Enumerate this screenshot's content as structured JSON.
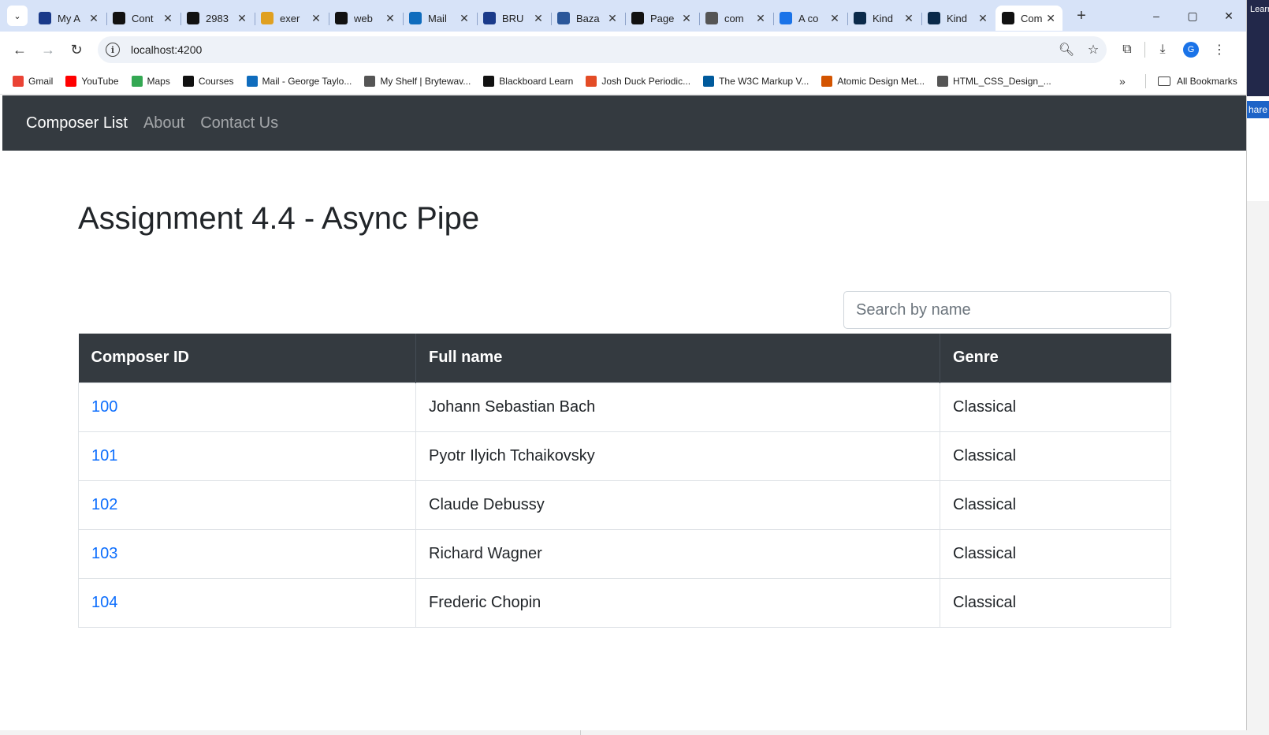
{
  "browser": {
    "tabs": [
      {
        "title": "My A",
        "favicon": "circle-icon",
        "color": "#1a3a8a"
      },
      {
        "title": "Cont",
        "favicon": "chart-icon",
        "color": "#111111"
      },
      {
        "title": "2983",
        "favicon": "blackboard-icon",
        "color": "#111111"
      },
      {
        "title": "exer",
        "favicon": "swirl-icon",
        "color": "#e0a020"
      },
      {
        "title": "web",
        "favicon": "github-icon",
        "color": "#111111"
      },
      {
        "title": "Mail",
        "favicon": "outlook-icon",
        "color": "#0f6cbd"
      },
      {
        "title": "BRU",
        "favicon": "circle-icon",
        "color": "#1a3a8a"
      },
      {
        "title": "Baza",
        "favicon": "word-icon",
        "color": "#2b579a"
      },
      {
        "title": "Page",
        "favicon": "github-icon",
        "color": "#111111"
      },
      {
        "title": "com",
        "favicon": "globe-icon",
        "color": "#555555"
      },
      {
        "title": "A co",
        "favicon": "s-icon",
        "color": "#1a73e8"
      },
      {
        "title": "Kind",
        "favicon": "k-icon",
        "color": "#0b2a4a"
      },
      {
        "title": "Kind",
        "favicon": "k-icon",
        "color": "#0b2a4a"
      },
      {
        "title": "Com",
        "favicon": "angular-icon",
        "color": "#111111",
        "active": true
      }
    ],
    "url": "localhost:4200",
    "bookmarks": [
      {
        "label": "Gmail",
        "favicon": "gmail-icon",
        "color": "#ea4335"
      },
      {
        "label": "YouTube",
        "favicon": "youtube-icon",
        "color": "#ff0000"
      },
      {
        "label": "Maps",
        "favicon": "maps-icon",
        "color": "#34a853"
      },
      {
        "label": "Courses",
        "favicon": "chart-icon",
        "color": "#111111"
      },
      {
        "label": "Mail - George Taylo...",
        "favicon": "outlook-icon",
        "color": "#0f6cbd"
      },
      {
        "label": "My Shelf | Brytewav...",
        "favicon": "book-icon",
        "color": "#555555"
      },
      {
        "label": "Blackboard Learn",
        "favicon": "chart-icon",
        "color": "#111111"
      },
      {
        "label": "Josh Duck Periodic...",
        "favicon": "jd-icon",
        "color": "#e34c26"
      },
      {
        "label": "The W3C Markup V...",
        "favicon": "w3c-icon",
        "color": "#005a9c"
      },
      {
        "label": "Atomic Design Met...",
        "favicon": "atom-icon",
        "color": "#d35400"
      },
      {
        "label": "HTML_CSS_Design_...",
        "favicon": "globe-icon",
        "color": "#555555"
      }
    ],
    "all_bookmarks": "All Bookmarks",
    "profile_initial": "G",
    "background_text": {
      "right_top": "Learn",
      "share": "hare"
    }
  },
  "app": {
    "navbar": {
      "brand": "Composer List",
      "links": [
        "About",
        "Contact Us"
      ]
    },
    "page_title": "Assignment 4.4 - Async Pipe",
    "search": {
      "placeholder": "Search by name",
      "value": ""
    },
    "table": {
      "headers": [
        "Composer ID",
        "Full name",
        "Genre"
      ],
      "rows": [
        {
          "id": "100",
          "name": "Johann Sebastian Bach",
          "genre": "Classical"
        },
        {
          "id": "101",
          "name": "Pyotr Ilyich Tchaikovsky",
          "genre": "Classical"
        },
        {
          "id": "102",
          "name": "Claude Debussy",
          "genre": "Classical"
        },
        {
          "id": "103",
          "name": "Richard Wagner",
          "genre": "Classical"
        },
        {
          "id": "104",
          "name": "Frederic Chopin",
          "genre": "Classical"
        }
      ]
    }
  }
}
